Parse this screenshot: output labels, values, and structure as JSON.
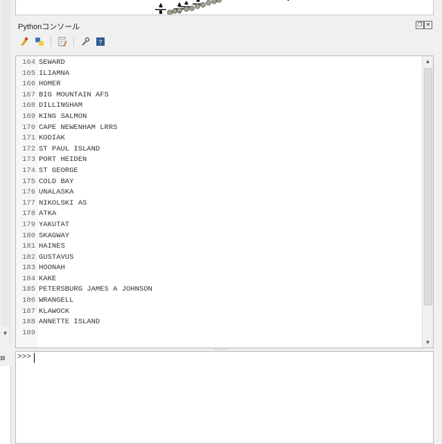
{
  "window": {
    "dock_title": "Pythonコンソール",
    "float_icon": "float-icon",
    "close_icon": "close-icon"
  },
  "toolbar": {
    "buttons": [
      {
        "name": "clear-console-icon"
      },
      {
        "name": "python-run-icon"
      },
      {
        "name": "show-editor-icon"
      },
      {
        "name": "settings-wrench-icon"
      },
      {
        "name": "help-icon"
      }
    ]
  },
  "editor": {
    "lines": [
      {
        "num": "164",
        "text": "SEWARD"
      },
      {
        "num": "165",
        "text": "ILIAMNA"
      },
      {
        "num": "166",
        "text": "HOMER"
      },
      {
        "num": "167",
        "text": "BIG MOUNTAIN AFS"
      },
      {
        "num": "168",
        "text": "DILLINGHAM"
      },
      {
        "num": "169",
        "text": "KING SALMON"
      },
      {
        "num": "170",
        "text": "CAPE NEWENHAM LRRS"
      },
      {
        "num": "171",
        "text": "KODIAK"
      },
      {
        "num": "172",
        "text": "ST PAUL ISLAND"
      },
      {
        "num": "173",
        "text": "PORT HEIDEN"
      },
      {
        "num": "174",
        "text": "ST GEORGE"
      },
      {
        "num": "175",
        "text": "COLD BAY"
      },
      {
        "num": "176",
        "text": "UNALASKA"
      },
      {
        "num": "177",
        "text": "NIKOLSKI AS"
      },
      {
        "num": "178",
        "text": "ATKA"
      },
      {
        "num": "179",
        "text": "YAKUTAT"
      },
      {
        "num": "180",
        "text": "SKAGWAY"
      },
      {
        "num": "181",
        "text": "HAINES"
      },
      {
        "num": "182",
        "text": "GUSTAVUS"
      },
      {
        "num": "183",
        "text": "HOONAH"
      },
      {
        "num": "184",
        "text": "KAKE"
      },
      {
        "num": "185",
        "text": "PETERSBURG JAMES A JOHNSON"
      },
      {
        "num": "186",
        "text": "WRANGELL"
      },
      {
        "num": "187",
        "text": "KLAWOCK"
      },
      {
        "num": "188",
        "text": "ANNETTE ISLAND"
      },
      {
        "num": "189",
        "text": ""
      }
    ]
  },
  "console": {
    "prompt": ">>>"
  }
}
